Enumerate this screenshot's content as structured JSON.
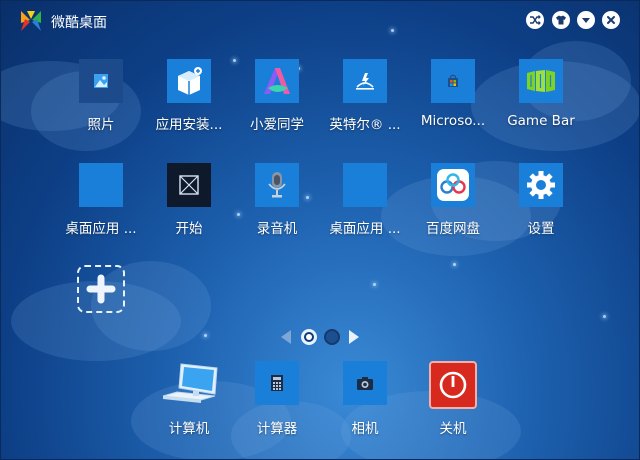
{
  "window": {
    "title": "微酷桌面"
  },
  "colors": {
    "tile_blue": "#1a7fd8",
    "background_top": "#0a2f6a",
    "background_glow": "#3a8ad6",
    "shutdown_red": "#d8291f"
  },
  "apps": [
    {
      "label": "照片",
      "icon": "photos-icon"
    },
    {
      "label": "应用安装...",
      "icon": "app-installer-icon"
    },
    {
      "label": "小爱同学",
      "icon": "xiaoai-icon"
    },
    {
      "label": "英特尔® ...",
      "icon": "intel-graphics-icon"
    },
    {
      "label": "Microso...",
      "icon": "microsoft-store-icon"
    },
    {
      "label": "Game Bar",
      "icon": "game-bar-icon"
    },
    {
      "label": "桌面应用 ...",
      "icon": "blank-tile-icon"
    },
    {
      "label": "开始",
      "icon": "start-icon"
    },
    {
      "label": "录音机",
      "icon": "voice-recorder-icon"
    },
    {
      "label": "桌面应用 ...",
      "icon": "blank-tile-icon"
    },
    {
      "label": "百度网盘",
      "icon": "baidu-netdisk-icon"
    },
    {
      "label": "设置",
      "icon": "settings-gear-icon"
    }
  ],
  "dock": [
    {
      "label": "计算机",
      "icon": "computer-icon"
    },
    {
      "label": "计算器",
      "icon": "calculator-icon"
    },
    {
      "label": "相机",
      "icon": "camera-icon"
    },
    {
      "label": "关机",
      "icon": "power-icon"
    }
  ],
  "pager": {
    "pages": 2,
    "current": 1
  }
}
